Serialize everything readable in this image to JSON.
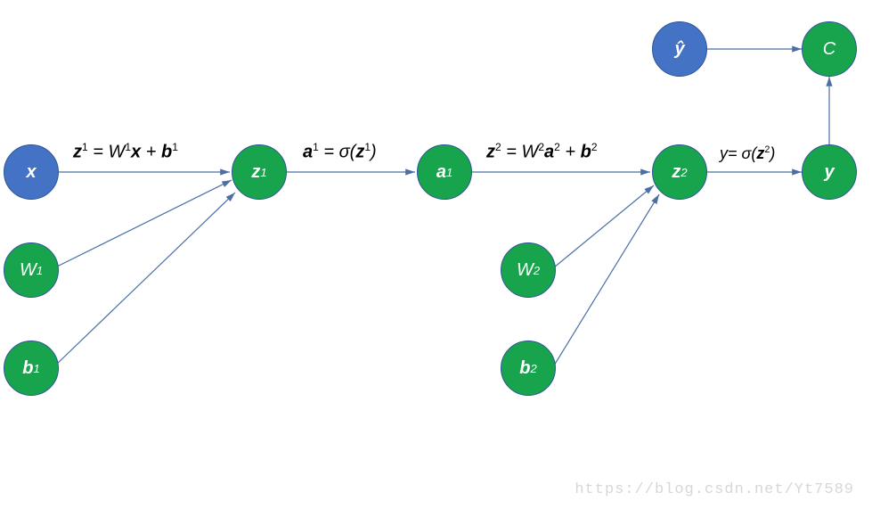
{
  "nodes": {
    "x": {
      "label_html": "<span class='bold'>x</span>"
    },
    "W1": {
      "label_html": "W<span class='nsup'>1</span>"
    },
    "b1": {
      "label_html": "<span class='bold'>b</span><span class='nsup'>1</span>"
    },
    "z1": {
      "label_html": "<span class='bold'>z</span><span class='nsup'>1</span>"
    },
    "a1": {
      "label_html": "<span class='bold'>a</span><span class='nsup'>1</span>"
    },
    "W2": {
      "label_html": "W<span class='nsup'>2</span>"
    },
    "b2": {
      "label_html": "<span class='bold'>b</span><span class='nsup'>2</span>"
    },
    "z2": {
      "label_html": "<span class='bold'>z</span><span class='nsup'>2</span>"
    },
    "y": {
      "label_html": "<span class='bold'>y</span>"
    },
    "yhat": {
      "label_html": "<span class='bold'>ŷ</span>"
    },
    "C": {
      "label_html": "C"
    }
  },
  "edge_labels": {
    "x_to_z1": "<span class='bold'>z</span><sup>1</sup> = W<sup>1</sup><span class='bold'>x</span> + <span class='bold'>b</span><sup>1</sup>",
    "z1_to_a1": "<span class='bold'>a</span><sup>1</sup> = σ(<span class='bold'>z</span><sup>1</sup>)",
    "a1_to_z2": "<span class='bold'>z</span><sup>2</sup> = W<sup>2</sup><span class='bold'>a</span><sup>2</sup> + <span class='bold'>b</span><sup>2</sup>",
    "z2_to_y": "y= σ(<span class='bold'>z</span><sup>2</sup>)"
  },
  "watermark": "https://blog.csdn.net/Yt7589",
  "colors": {
    "green": "#18A44C",
    "blue": "#4472C4",
    "line": "#4A6FA5"
  }
}
